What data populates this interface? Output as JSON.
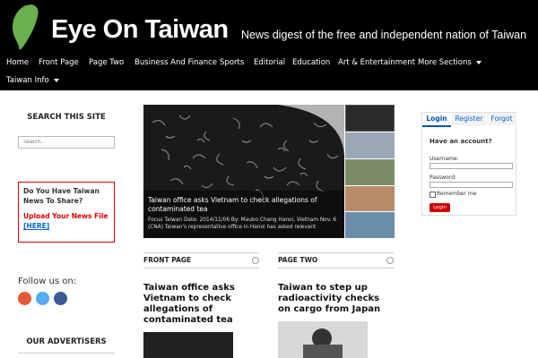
{
  "header": {
    "site_title": "Eye On Taiwan",
    "tagline": "News digest of the free and independent nation of Taiwan"
  },
  "nav": {
    "items": [
      "Home",
      "Front Page",
      "Page Two",
      "Business And Finance",
      "Sports",
      "Editorial",
      "Education",
      "Art & Entertainment",
      "More Sections"
    ],
    "taiwan_info": "Taiwan Info"
  },
  "sidebar": {
    "search_title": "SEARCH THIS SITE",
    "search_placeholder": "Search...",
    "submit_question": "Do You Have Taiwan News To Share?",
    "submit_link": "Upload Your News File",
    "submit_here": "[HERE]",
    "follow_title": "Follow us on:",
    "advertisers_title": "OUR ADVERTISERS"
  },
  "slider": {
    "caption": "Taiwan office asks Vietnam to check allegations of contaminated tea",
    "excerpt": "Focus Taiwan Date: 2014/11/06 By: Maubo Chang Hanoi, Vietnam Nov. 6 (CNA) Taiwan's representative office in Hanoi has asked relevant"
  },
  "sections": {
    "front_page": "FRONT PAGE",
    "page_two": "PAGE TWO"
  },
  "articles": {
    "front_title": "Taiwan office asks Vietnam to check allegations of contaminated tea",
    "two_title": "Taiwan to step up radioactivity checks on cargo from Japan"
  },
  "login": {
    "tab_login": "Login",
    "tab_register": "Register",
    "tab_forgot": "Forgot",
    "prompt": "Have an account?",
    "username_label": "Username:",
    "password_label": "Password:",
    "remember_label": "Remember me",
    "button_label": "Login"
  },
  "colors": {
    "accent": "#c00000",
    "link": "#0066cc",
    "logo_green": "#6ab04c"
  }
}
